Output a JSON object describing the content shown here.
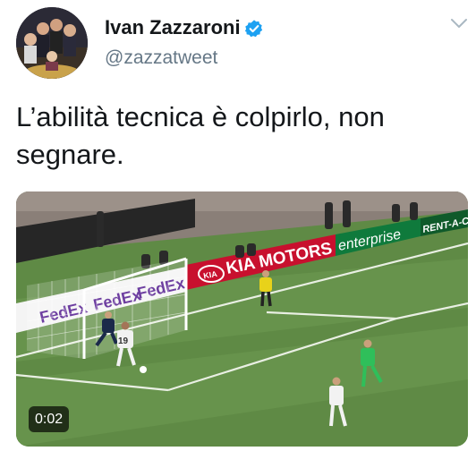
{
  "author": {
    "display_name": "Ivan Zazzaroni",
    "handle": "@zazzatweet",
    "verified": true
  },
  "tweet": {
    "text_line1": "L’abilità tecnica è colpirlo, non",
    "text_line2": "segnare."
  },
  "media": {
    "type": "video",
    "timestamp": "0:02",
    "boards": {
      "kia": "KIA MOTORS",
      "kia_logo": "KIA",
      "enterprise": "enterprise",
      "rentacar": "RENT-A-CA",
      "fedex1": "FedEx",
      "fedex2": "FedEx",
      "fedex3": "FedEx"
    },
    "shirt_number": "19"
  },
  "colors": {
    "verified_blue": "#1da1f2",
    "pitch_green": "#5f8a45",
    "kia_red": "#c8102e",
    "enterprise_green": "#0f7a3c"
  }
}
